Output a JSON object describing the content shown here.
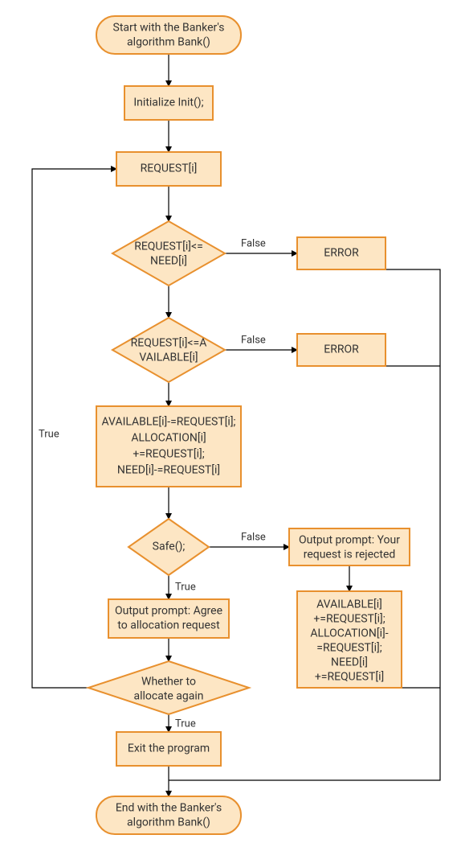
{
  "nodes": {
    "start": {
      "lines": [
        "Start with the Banker's",
        "algorithm Bank()"
      ]
    },
    "init": {
      "lines": [
        "Initialize Init();"
      ]
    },
    "request": {
      "lines": [
        "REQUEST[i]"
      ]
    },
    "cond_need": {
      "lines": [
        "REQUEST[i]<=",
        "NEED[i]"
      ]
    },
    "err1": {
      "lines": [
        "ERROR"
      ]
    },
    "cond_avail": {
      "lines": [
        "REQUEST[i]<=A",
        "VAILABLE[i]"
      ]
    },
    "err2": {
      "lines": [
        "ERROR"
      ]
    },
    "alloc": {
      "lines": [
        "AVAILABLE[i]-=REQUEST[i];",
        "ALLOCATION[i]",
        "+=REQUEST[i];",
        "NEED[i]-=REQUEST[i]"
      ]
    },
    "safe": {
      "lines": [
        "Safe();"
      ]
    },
    "reject": {
      "lines": [
        "Output prompt: Your",
        "request is rejected"
      ]
    },
    "agree": {
      "lines": [
        "Output prompt: Agree",
        "to allocation request"
      ]
    },
    "rollback": {
      "lines": [
        "AVAILABLE[i]",
        "+=REQUEST[i];",
        "ALLOCATION[i]-",
        "=REQUEST[i];",
        "NEED[i]",
        "+=REQUEST[i]"
      ]
    },
    "again": {
      "lines": [
        "Whether to",
        "allocate again"
      ]
    },
    "exit": {
      "lines": [
        "Exit the program"
      ]
    },
    "end": {
      "lines": [
        "End with the Banker's",
        "algorithm Bank()"
      ]
    }
  },
  "labels": {
    "true": "True",
    "false": "False"
  }
}
